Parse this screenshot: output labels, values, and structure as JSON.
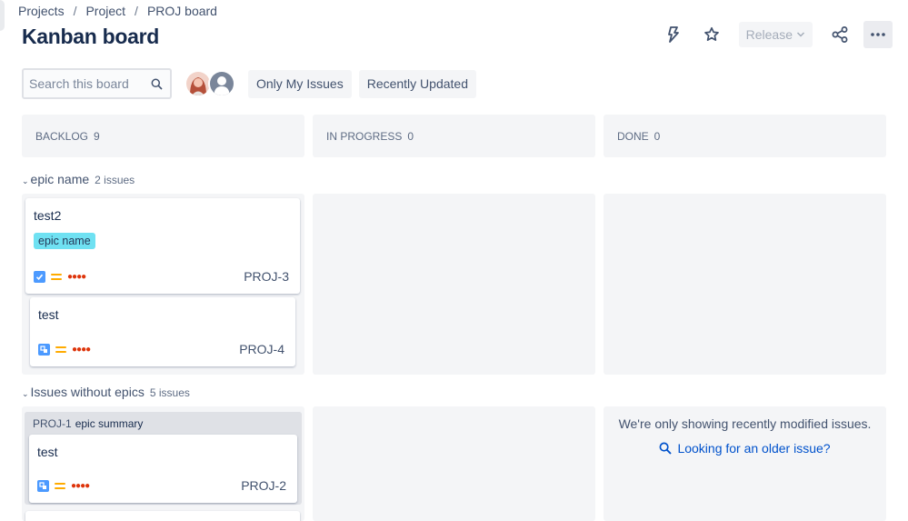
{
  "breadcrumbs": [
    "Projects",
    "Project",
    "PROJ board"
  ],
  "page_title": "Kanban board",
  "actions": {
    "release_label": "Release"
  },
  "search": {
    "placeholder": "Search this board"
  },
  "filters": [
    "Only My Issues",
    "Recently Updated"
  ],
  "columns": [
    {
      "name": "BACKLOG",
      "count": "9"
    },
    {
      "name": "IN PROGRESS",
      "count": "0"
    },
    {
      "name": "DONE",
      "count": "0"
    }
  ],
  "swimlanes": [
    {
      "title": "epic name",
      "count": "2 issues"
    },
    {
      "title": "Issues without epics",
      "count": "5 issues"
    }
  ],
  "cards": [
    {
      "summary": "test2",
      "epic": "epic name",
      "key": "PROJ-3",
      "type": "task"
    },
    {
      "summary": "test",
      "key": "PROJ-4",
      "type": "subtask"
    },
    {
      "summary": "test",
      "key": "PROJ-2",
      "type": "subtask",
      "parent_key": "PROJ-1",
      "parent_summary": "epic summary"
    }
  ],
  "done_column": {
    "message": "We're only showing recently modified issues.",
    "link": "Looking for an older issue?"
  },
  "colors": {
    "epic_lozenge": "#6fe1f2",
    "task_blue": "#4c9aff",
    "priority_medium": "#ffab00",
    "estimate_dots": "#de350b",
    "link": "#0052cc"
  }
}
